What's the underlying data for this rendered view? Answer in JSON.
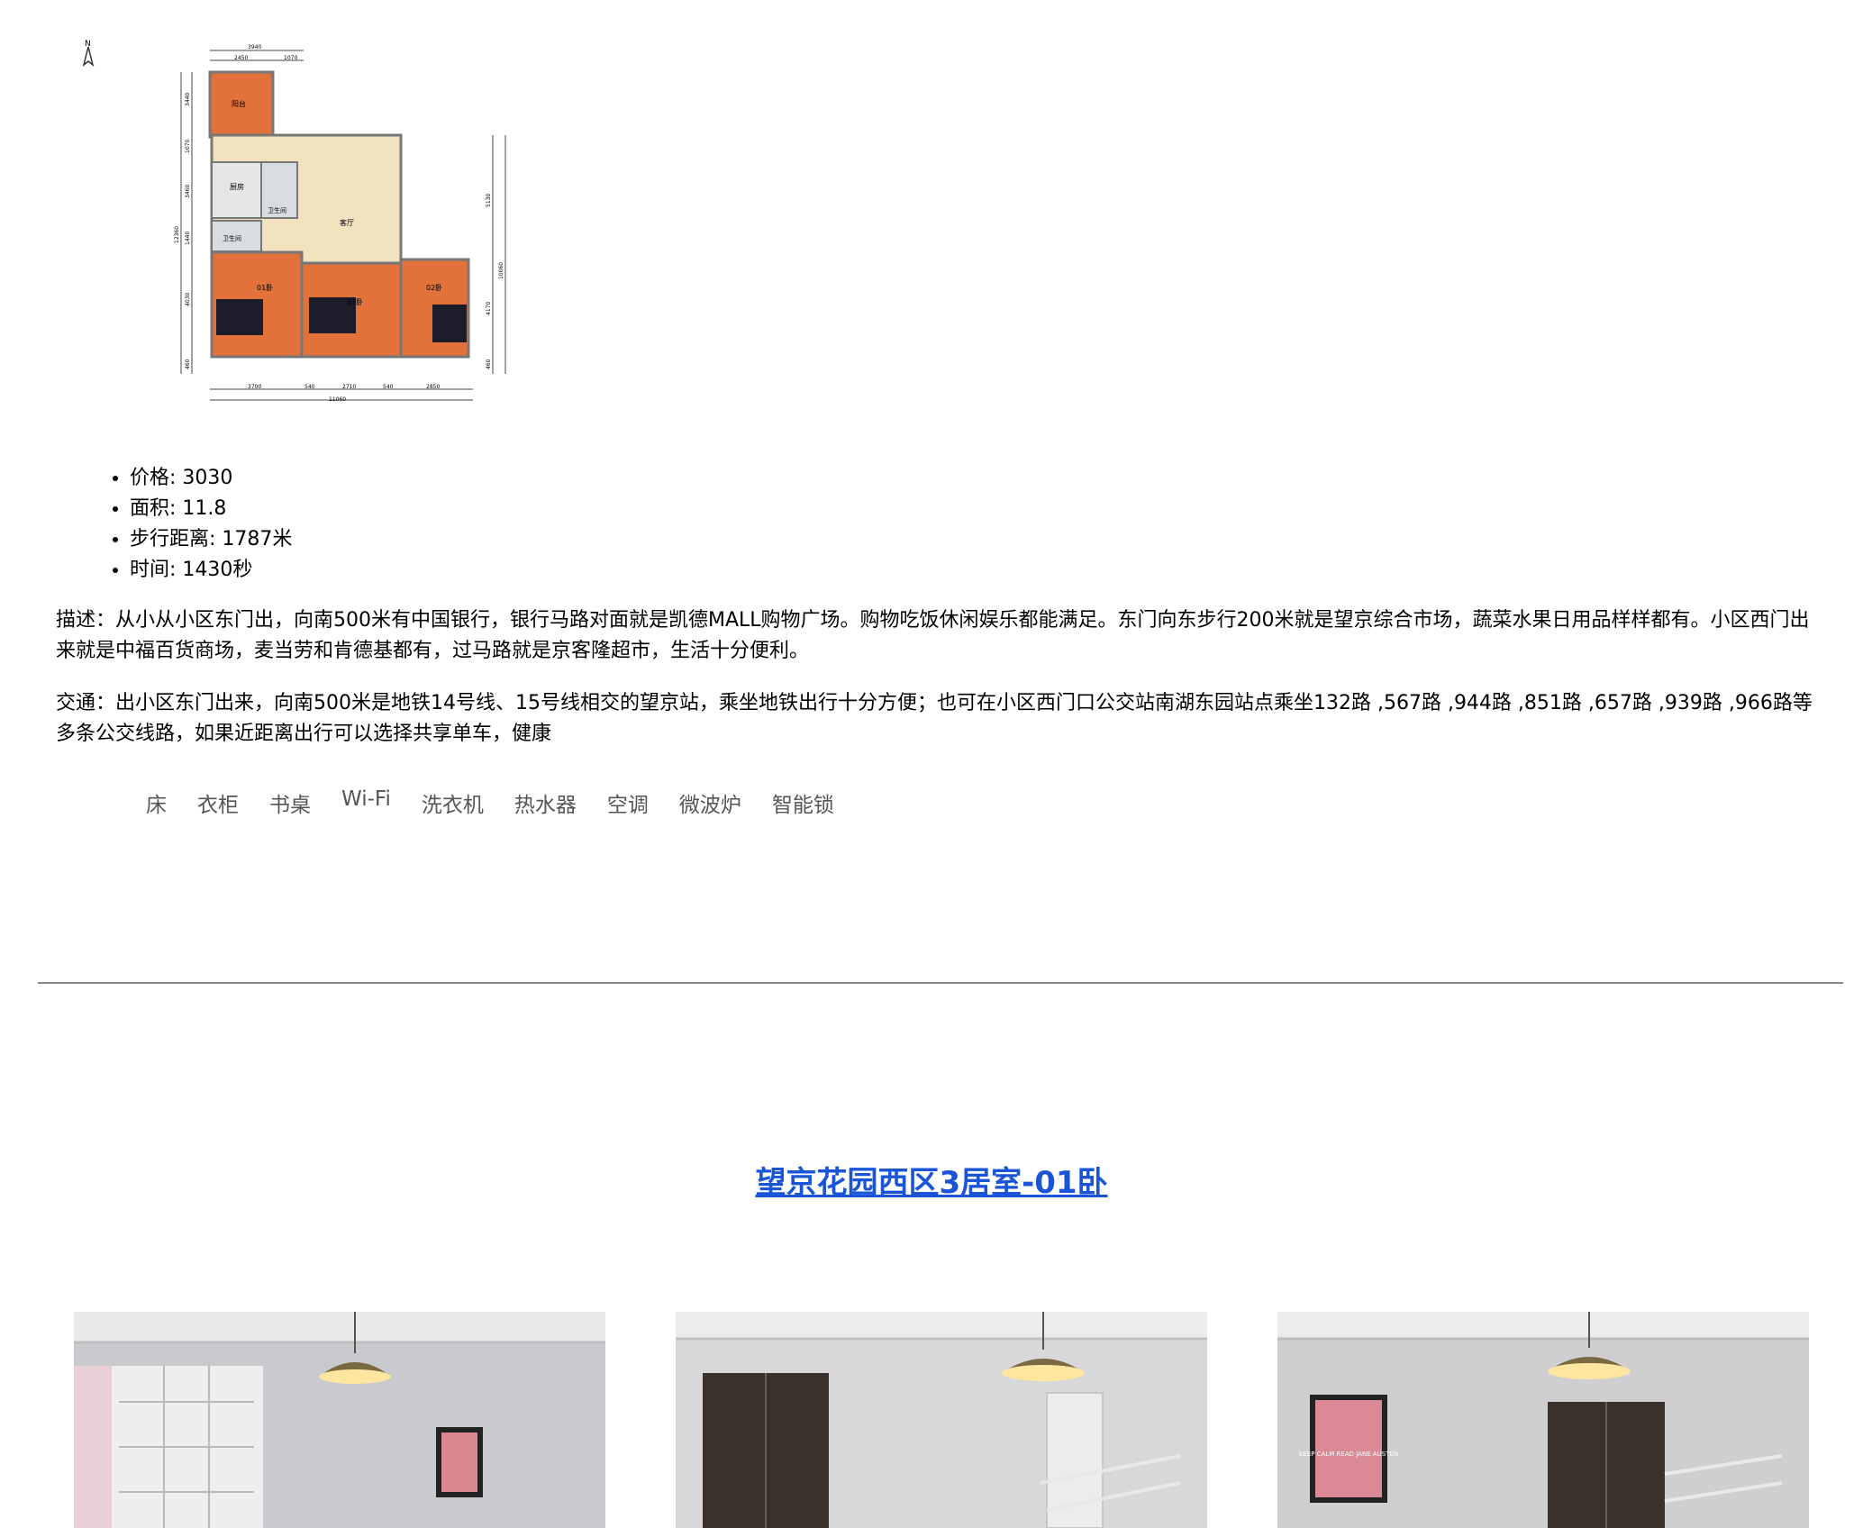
{
  "floorplan": {
    "dimensions_top": [
      "3940",
      "2450",
      "1070"
    ],
    "dimensions_bottom": [
      "3700",
      "540",
      "2710",
      "540",
      "2850"
    ],
    "dimension_total_bottom": "11060",
    "dimensions_left": [
      "3440",
      "1070",
      "3460",
      "1440",
      "4030",
      "460",
      "12360"
    ],
    "dimensions_right": [
      "5130",
      "4170",
      "460",
      "10060"
    ],
    "rooms": {
      "balcony": "阳台",
      "kitchen": "厨房",
      "bath1": "卫生间",
      "bath2": "卫生间",
      "living": "客厅",
      "bed1": "01卧",
      "bed2": "03卧",
      "bed3": "02卧"
    }
  },
  "specs": [
    {
      "label": "价格",
      "value": "3030"
    },
    {
      "label": "面积",
      "value": "11.8"
    },
    {
      "label": "步行距离",
      "value": "1787米"
    },
    {
      "label": "时间",
      "value": "1430秒"
    }
  ],
  "description": "描述：从小从小区东门出，向南500米有中国银行，银行马路对面就是凯德MALL购物广场。购物吃饭休闲娱乐都能满足。东门向东步行200米就是望京综合市场，蔬菜水果日用品样样都有。小区西门出来就是中福百货商场，麦当劳和肯德基都有，过马路就是京客隆超市，生活十分便利。",
  "traffic": "交通：出小区东门出来，向南500米是地铁14号线、15号线相交的望京站，乘坐地铁出行十分方便；也可在小区西门口公交站南湖东园站点乘坐132路 ,567路 ,944路 ,851路 ,657路 ,939路 ,966路等多条公交线路，如果近距离出行可以选择共享单车，健康",
  "amenities": [
    "床",
    "衣柜",
    "书桌",
    "Wi-Fi",
    "洗衣机",
    "热水器",
    "空调",
    "微波炉",
    "智能锁"
  ],
  "room_title": "望京花园西区3居室-01卧",
  "photos": [
    {
      "poster": ""
    },
    {
      "poster": ""
    },
    {
      "poster": "KEEP CALM READ JANE AUSTEN"
    }
  ],
  "colors": {
    "link": "#1a55d8",
    "floor_wood": "#e2713a",
    "living_floor": "#f3e2c0"
  }
}
